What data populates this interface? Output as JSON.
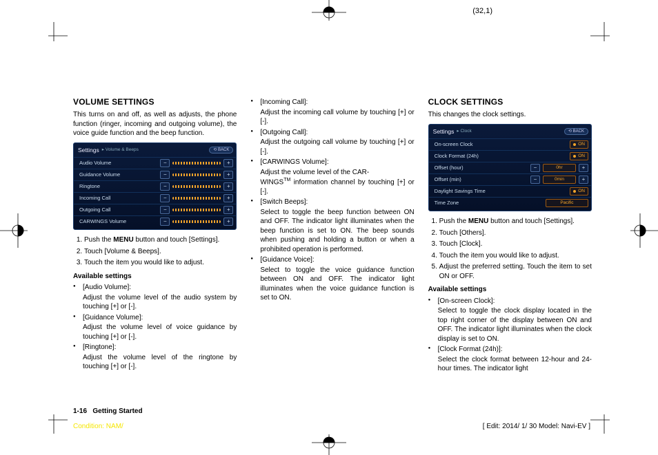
{
  "page_marker_top": "(32,1)",
  "col1": {
    "h": "VOLUME SETTINGS",
    "intro": "This turns on and off, as well as adjusts, the phone function (ringer, incoming and outgoing volume), the voice guide function and the beep function.",
    "panel": {
      "title": "Settings",
      "sub": "▸ Volume & Beeps",
      "back": "⟲ BACK",
      "rows": [
        "Audio Volume",
        "Guidance Volume",
        "Ringtone",
        "Incoming Call",
        "Outgoing Call",
        "CARWINGS Volume"
      ]
    },
    "steps": [
      "Push the MENU button and touch [Settings].",
      "Touch [Volume & Beeps].",
      "Touch the item you would like to adjust."
    ],
    "avail_h": "Available settings",
    "bullets": [
      {
        "label": "[Audio Volume]:",
        "desc": "Adjust the volume level of the audio system by touching [+] or [-]."
      },
      {
        "label": "[Guidance Volume]:",
        "desc": "Adjust the volume level of voice guidance by touching [+] or [-]."
      },
      {
        "label": "[Ringtone]:",
        "desc": "Adjust the volume level of the ringtone by touching [+] or [-]."
      }
    ]
  },
  "col2": {
    "bullets": [
      {
        "label": "[Incoming Call]:",
        "desc": "Adjust the incoming call volume by touching [+] or [-]."
      },
      {
        "label": "[Outgoing Call]:",
        "desc": "Adjust the outgoing call volume by touching [+] or [-]."
      },
      {
        "label": "[CARWINGS Volume]:",
        "desc": "Adjust the volume level of the CARWINGSTM information channel by touching [+] or [-]."
      },
      {
        "label": "[Switch Beeps]:",
        "desc": "Select to toggle the beep function between ON and OFF. The indicator light illuminates when the beep function is set to ON. The beep sounds when pushing and holding a button or when a prohibited operation is performed."
      },
      {
        "label": "[Guidance Voice]:",
        "desc": "Select to toggle the voice guidance function between ON and OFF. The indicator light illuminates when the voice guidance function is set to ON."
      }
    ]
  },
  "col3": {
    "h": "CLOCK SETTINGS",
    "intro": "This changes the clock settings.",
    "panel": {
      "title": "Settings",
      "sub": "▸ Clock",
      "back": "⟲ BACK",
      "rows": [
        {
          "label": "On-screen Clock",
          "type": "on"
        },
        {
          "label": "Clock Format (24h)",
          "type": "on"
        },
        {
          "label": "Offset (hour)",
          "type": "val",
          "val": "0hr"
        },
        {
          "label": "Offset (min)",
          "type": "val",
          "val": "0min"
        },
        {
          "label": "Daylight Savings Time",
          "type": "on"
        },
        {
          "label": "Time Zone",
          "type": "plain",
          "val": "Pacific"
        }
      ]
    },
    "steps": [
      "Push the MENU button and touch [Settings].",
      "Touch [Others].",
      "Touch [Clock].",
      "Touch the item you would like to adjust.",
      "Adjust the preferred setting. Touch the item to set ON or OFF."
    ],
    "avail_h": "Available settings",
    "bullets": [
      {
        "label": "[On-screen Clock]:",
        "desc": "Select to toggle the clock display located in the top right corner of the display between ON and OFF. The indicator light illuminates when the clock display is set to ON."
      },
      {
        "label": "[Clock Format (24h)]:",
        "desc": "Select the clock format between 12-hour and 24-hour times. The indicator light"
      }
    ]
  },
  "footer": {
    "pagefoot_num": "1-16",
    "pagefoot_section": "Getting Started",
    "condition": "Condition: NAM/",
    "edit": "[ Edit: 2014/ 1/ 30   Model:  Navi-EV ]"
  }
}
